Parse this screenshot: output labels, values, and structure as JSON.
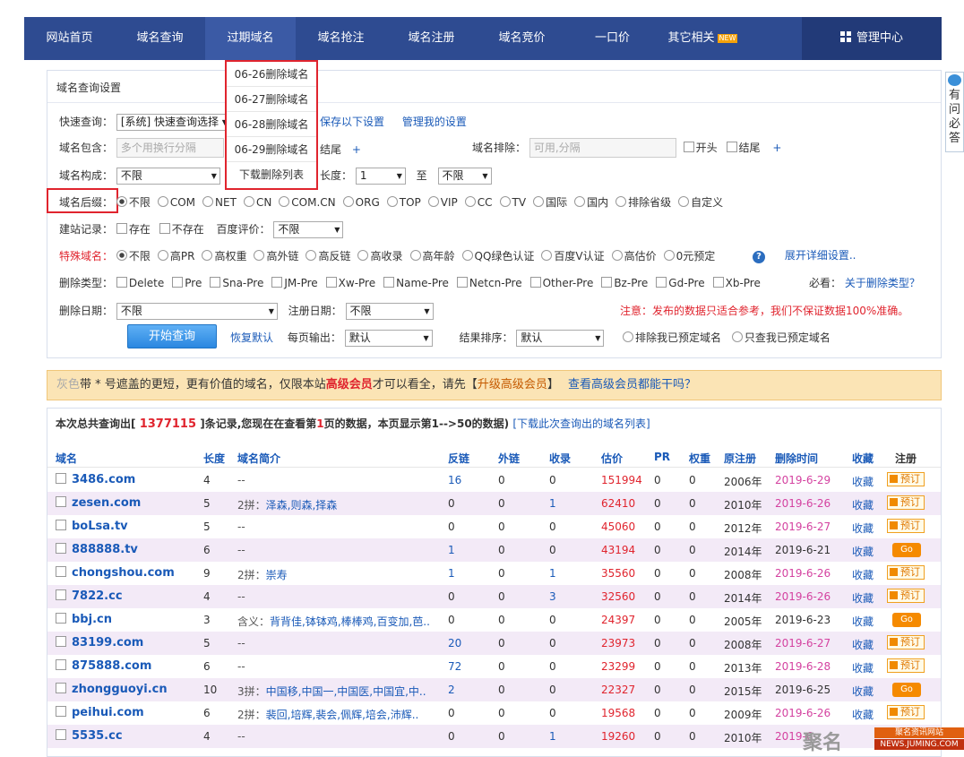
{
  "nav": {
    "items": [
      "网站首页",
      "域名查询",
      "过期域名",
      "域名抢注",
      "域名注册",
      "域名竞价",
      "一口价",
      "其它相关"
    ],
    "new_badge": "NEW",
    "admin": "管理中心"
  },
  "dropdown": [
    "06-26删除域名",
    "06-27删除域名",
    "06-28删除域名",
    "06-29删除域名",
    "下载删除列表"
  ],
  "side": {
    "text": "有问必答"
  },
  "panel": {
    "title": "域名查询设置",
    "quick_label": "快速查询：",
    "quick_value": "[系统] 快速查询选择",
    "save_link": "保存以下设置",
    "manage_link": "管理我的设置",
    "contain_label": "域名包含：",
    "contain_placeholder": "多个用换行分隔",
    "tail": "结尾",
    "plus": "+",
    "exclude_label": "域名排除：",
    "exclude_placeholder": "可用,分隔",
    "head": "开头",
    "compose_label": "域名构成：",
    "compose_value": "不限",
    "length_label": "长度：",
    "length_value": "1",
    "to": "至",
    "length_to_value": "不限",
    "suffix_label": "域名后缀：",
    "suffix_options": [
      "不限",
      "COM",
      "NET",
      "CN",
      "COM.CN",
      "ORG",
      "TOP",
      "VIP",
      "CC",
      "TV",
      "国际",
      "国内",
      "排除省级",
      "自定义"
    ],
    "site_label": "建站记录：",
    "site_exist": "存在",
    "site_not": "不存在",
    "baidu_label": "百度评价：",
    "baidu_value": "不限",
    "special_label": "特殊域名：",
    "special_options": [
      "不限",
      "高PR",
      "高权重",
      "高外链",
      "高反链",
      "高收录",
      "高年龄",
      "QQ绿色认证",
      "百度V认证",
      "高估价",
      "0元预定"
    ],
    "help": "?",
    "expand_link": "展开详细设置..",
    "del_type_label": "删除类型：",
    "del_types": [
      "Delete",
      "Pre",
      "Sna-Pre",
      "JM-Pre",
      "Xw-Pre",
      "Name-Pre",
      "Netcn-Pre",
      "Other-Pre",
      "Bz-Pre",
      "Gd-Pre",
      "Xb-Pre"
    ],
    "must_see": "必看：",
    "about_link": "关于删除类型？",
    "del_date_label": "删除日期：",
    "del_date_value": "不限",
    "reg_date_label": "注册日期：",
    "reg_date_value": "不限",
    "warning": "注意：发布的数据只适合参考，我们不保证数据100%准确。",
    "query_button": "开始查询",
    "reset_link": "恢复默认",
    "per_page_label": "每页输出：",
    "per_page_value": "默认",
    "sort_label": "结果排序：",
    "sort_value": "默认",
    "exclude_mine": "排除我已预定域名",
    "only_mine": "只查我已预定域名"
  },
  "notice": {
    "gray": "灰色",
    "t1": "带 * 号遮盖的更短，更有价值的域名，仅限本站",
    "vip": "高级会员",
    "t2": "才可以看全，请先【",
    "upgrade": "升级高级会员",
    "t3": "】",
    "link": "查看高级会员都能干吗？"
  },
  "summary": {
    "pre": "本次总共查询出[",
    "count": "1377115",
    "mid": "]条记录,您现在在查看第",
    "page": "1",
    "post": "页的数据，本页显示第1-->50的数据)",
    "download": "[下载此次查询出的域名列表]"
  },
  "table": {
    "headers": [
      "域名",
      "长度",
      "域名简介",
      "反链",
      "外链",
      "收录",
      "估价",
      "PR",
      "权重",
      "原注册",
      "删除时间",
      "收藏",
      "注册"
    ],
    "rows": [
      {
        "domain": "3486.com",
        "len": "4",
        "intro_a": "--",
        "intro_b": "",
        "back": "16",
        "ext": "0",
        "inc": "0",
        "est": "151994",
        "pr": "0",
        "wt": "0",
        "reg": "2006年",
        "del": "2019-6-29",
        "fav": "收藏",
        "action": "预订"
      },
      {
        "domain": "zesen.com",
        "len": "5",
        "intro_a": "2拼：",
        "intro_b": "泽森,则森,择森",
        "back": "0",
        "ext": "0",
        "inc": "1",
        "est": "62410",
        "pr": "0",
        "wt": "0",
        "reg": "2010年",
        "del": "2019-6-26",
        "fav": "收藏",
        "action": "预订"
      },
      {
        "domain": "boLsa.tv",
        "len": "5",
        "intro_a": "--",
        "intro_b": "",
        "back": "0",
        "ext": "0",
        "inc": "0",
        "est": "45060",
        "pr": "0",
        "wt": "0",
        "reg": "2012年",
        "del": "2019-6-27",
        "fav": "收藏",
        "action": "预订"
      },
      {
        "domain": "888888.tv",
        "len": "6",
        "intro_a": "--",
        "intro_b": "",
        "back": "1",
        "ext": "0",
        "inc": "0",
        "est": "43194",
        "pr": "0",
        "wt": "0",
        "reg": "2014年",
        "del": "2019-6-21",
        "fav": "收藏",
        "action": "Go"
      },
      {
        "domain": "chongshou.com",
        "len": "9",
        "intro_a": "2拼：",
        "intro_b": "崇寿",
        "back": "1",
        "ext": "0",
        "inc": "1",
        "est": "35560",
        "pr": "0",
        "wt": "0",
        "reg": "2008年",
        "del": "2019-6-26",
        "fav": "收藏",
        "action": "预订"
      },
      {
        "domain": "7822.cc",
        "len": "4",
        "intro_a": "--",
        "intro_b": "",
        "back": "0",
        "ext": "0",
        "inc": "3",
        "est": "32560",
        "pr": "0",
        "wt": "0",
        "reg": "2014年",
        "del": "2019-6-26",
        "fav": "收藏",
        "action": "预订"
      },
      {
        "domain": "bbj.cn",
        "len": "3",
        "intro_a": "含义：",
        "intro_b": "背背佳,钵钵鸡,棒棒鸡,百变加,芭..",
        "back": "0",
        "ext": "0",
        "inc": "0",
        "est": "24397",
        "pr": "0",
        "wt": "0",
        "reg": "2005年",
        "del": "2019-6-23",
        "fav": "收藏",
        "action": "Go"
      },
      {
        "domain": "83199.com",
        "len": "5",
        "intro_a": "--",
        "intro_b": "",
        "back": "20",
        "ext": "0",
        "inc": "0",
        "est": "23973",
        "pr": "0",
        "wt": "0",
        "reg": "2008年",
        "del": "2019-6-27",
        "fav": "收藏",
        "action": "预订"
      },
      {
        "domain": "875888.com",
        "len": "6",
        "intro_a": "--",
        "intro_b": "",
        "back": "72",
        "ext": "0",
        "inc": "0",
        "est": "23299",
        "pr": "0",
        "wt": "0",
        "reg": "2013年",
        "del": "2019-6-28",
        "fav": "收藏",
        "action": "预订"
      },
      {
        "domain": "zhongguoyi.cn",
        "len": "10",
        "intro_a": "3拼：",
        "intro_b": "中国移,中国一,中国医,中国宜,中..",
        "back": "2",
        "ext": "0",
        "inc": "0",
        "est": "22327",
        "pr": "0",
        "wt": "0",
        "reg": "2015年",
        "del": "2019-6-25",
        "fav": "收藏",
        "action": "Go"
      },
      {
        "domain": "peihui.com",
        "len": "6",
        "intro_a": "2拼：",
        "intro_b": "裴回,培辉,裴会,佩辉,培会,沛辉..",
        "back": "0",
        "ext": "0",
        "inc": "0",
        "est": "19568",
        "pr": "0",
        "wt": "0",
        "reg": "2009年",
        "del": "2019-6-26",
        "fav": "收藏",
        "action": "预订"
      },
      {
        "domain": "5535.cc",
        "len": "4",
        "intro_a": "--",
        "intro_b": "",
        "back": "0",
        "ext": "0",
        "inc": "1",
        "est": "19260",
        "pr": "0",
        "wt": "0",
        "reg": "2010年",
        "del": "2019-6-",
        "fav": "",
        "action": ""
      }
    ]
  },
  "watermark": {
    "logo": "聚名",
    "line1": "聚名资讯网站",
    "line2": "NEWS.JUMING.COM"
  }
}
